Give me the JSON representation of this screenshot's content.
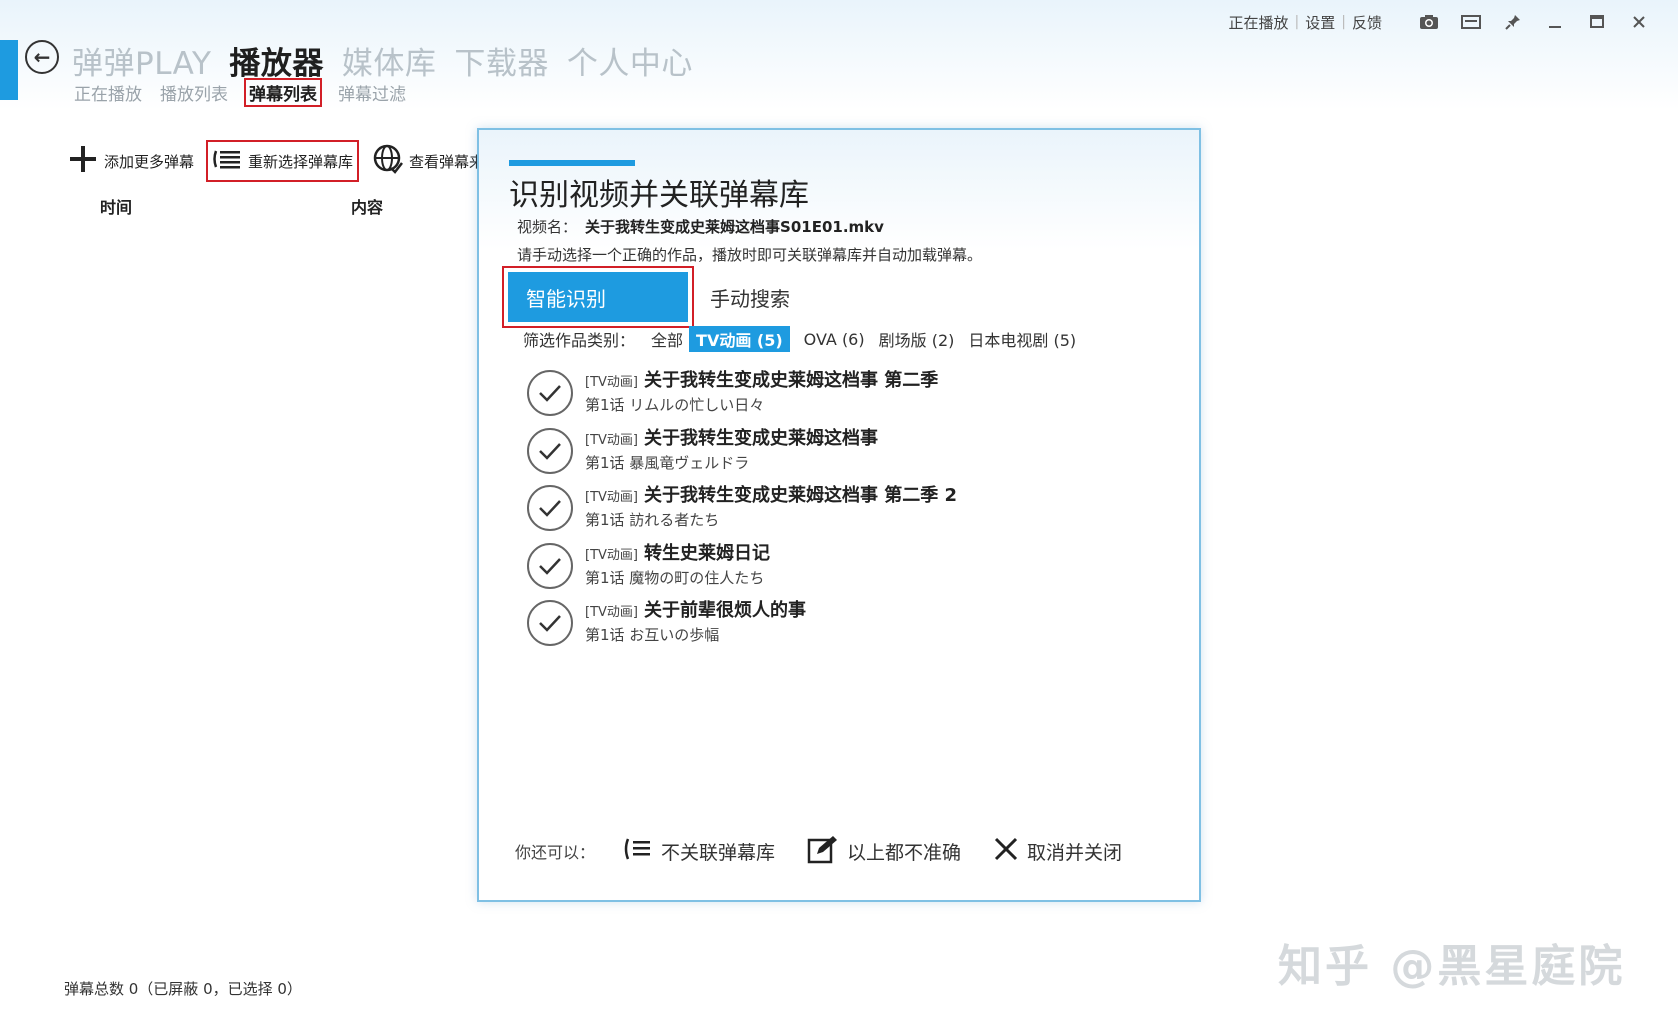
{
  "app": {
    "main_nav": [
      "弹弹PLAY",
      "播放器",
      "媒体库",
      "下载器",
      "个人中心"
    ],
    "sub_nav": [
      "正在播放",
      "播放列表",
      "弹幕列表",
      "弹幕过滤"
    ],
    "window_links": [
      "正在播放",
      "设置",
      "反馈"
    ],
    "window_icons": [
      "camera-icon",
      "window-mode-icon",
      "pin-icon",
      "minimize-icon",
      "maximize-icon",
      "close-icon"
    ]
  },
  "toolbar": {
    "add_label": "添加更多弹幕",
    "reselect_label": "重新选择弹幕库",
    "view_label": "查看弹幕来"
  },
  "columns": {
    "time": "时间",
    "content": "内容"
  },
  "status": "弹幕总数 0（已屏蔽 0，已选择 0）",
  "dialog": {
    "title": "识别视频并关联弹幕库",
    "video_label": "视频名：",
    "video_name": "关于我转生变成史莱姆这档事S01E01.mkv",
    "hint": "请手动选择一个正确的作品，播放时即可关联弹幕库并自动加载弹幕。",
    "tabs": {
      "smart": "智能识别",
      "manual": "手动搜索"
    },
    "filter": {
      "label": "筛选作品类别：",
      "items": [
        "全部",
        "TV动画 (5)",
        "OVA (6)",
        "剧场版 (2)",
        "日本电视剧 (5)"
      ]
    },
    "results": [
      {
        "tag": "[TV动画]",
        "title": "关于我转生变成史莱姆这档事 第二季",
        "episode": "第1话 リムルの忙しい日々"
      },
      {
        "tag": "[TV动画]",
        "title": "关于我转生变成史莱姆这档事",
        "episode": "第1话 暴風竜ヴェルドラ"
      },
      {
        "tag": "[TV动画]",
        "title": "关于我转生变成史莱姆这档事 第二季 2",
        "episode": "第1话 訪れる者たち"
      },
      {
        "tag": "[TV动画]",
        "title": "转生史莱姆日记",
        "episode": "第1话 魔物の町の住人たち"
      },
      {
        "tag": "[TV动画]",
        "title": "关于前辈很烦人的事",
        "episode": "第1话 お互いの歩幅"
      }
    ],
    "footer": {
      "label": "你还可以：",
      "no_link": "不关联弹幕库",
      "none_correct": "以上都不准确",
      "cancel_close": "取消并关闭"
    }
  },
  "watermark": "知乎 @黑星庭院",
  "colors": {
    "accent": "#1e9be0",
    "highlight_border": "#d21f27",
    "inactive_nav": "#b8c2c9"
  }
}
